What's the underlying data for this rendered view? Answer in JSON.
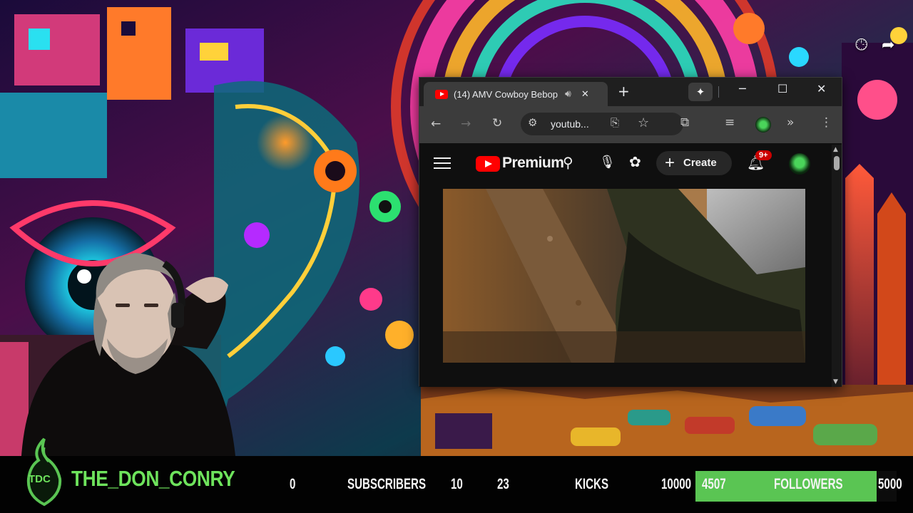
{
  "browser": {
    "tab_title": "(14) AMV Cowboy Bebop",
    "url": "youtub...",
    "new_tab": "+",
    "window": {
      "minimize": "─",
      "maximize": "☐",
      "close": "✕"
    }
  },
  "youtube": {
    "logo_text": "Premium",
    "create_label": "Create",
    "notifications_badge": "9+"
  },
  "stream_overlay": {
    "logo_text": "TDC",
    "channel_name": "THE_DON_CONRY",
    "subscribers": {
      "current": "0",
      "label": "SUBSCRIBERS",
      "goal": "10"
    },
    "kicks": {
      "current": "23",
      "label": "KICKS",
      "goal": "10000"
    },
    "followers": {
      "current": "4507",
      "label": "FOLLOWERS",
      "goal": "5000",
      "progress": 0.9014
    }
  },
  "corner_icons": [
    "watch-later-icon",
    "share-icon"
  ],
  "colors": {
    "accent_green": "#5ac553",
    "youtube_red": "#ff0000",
    "channel_green": "#6ee35c"
  }
}
